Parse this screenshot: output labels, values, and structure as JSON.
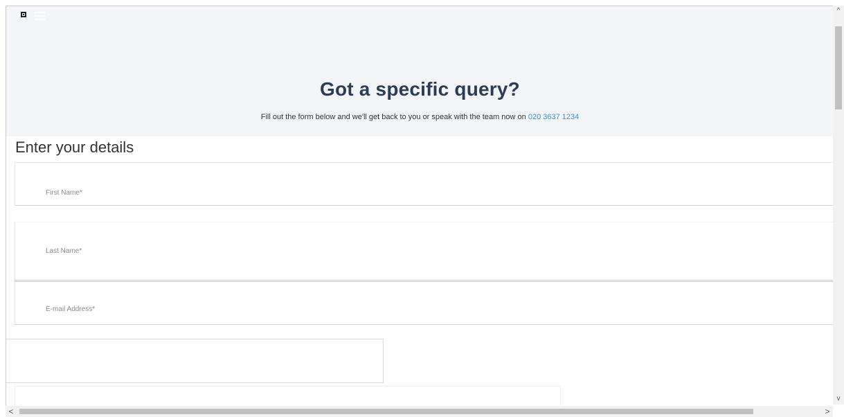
{
  "hero": {
    "title": "Got a specific query?",
    "subtitle_prefix": "Fill out the form below and we'll get back to you or speak with the team now on ",
    "phone": "020 3637 1234"
  },
  "form": {
    "heading": "Enter your details",
    "first_name_placeholder": "First Name*",
    "last_name_placeholder": "Last Name*",
    "email_placeholder": "E-mail Address*"
  },
  "scrollbars": {
    "up_arrow": "^",
    "down_arrow": "v",
    "left_arrow": "<",
    "right_arrow": ">"
  },
  "colors": {
    "hero_background": "#f3f5f9",
    "title": "#2b3c55",
    "link": "#3a8ee6"
  }
}
